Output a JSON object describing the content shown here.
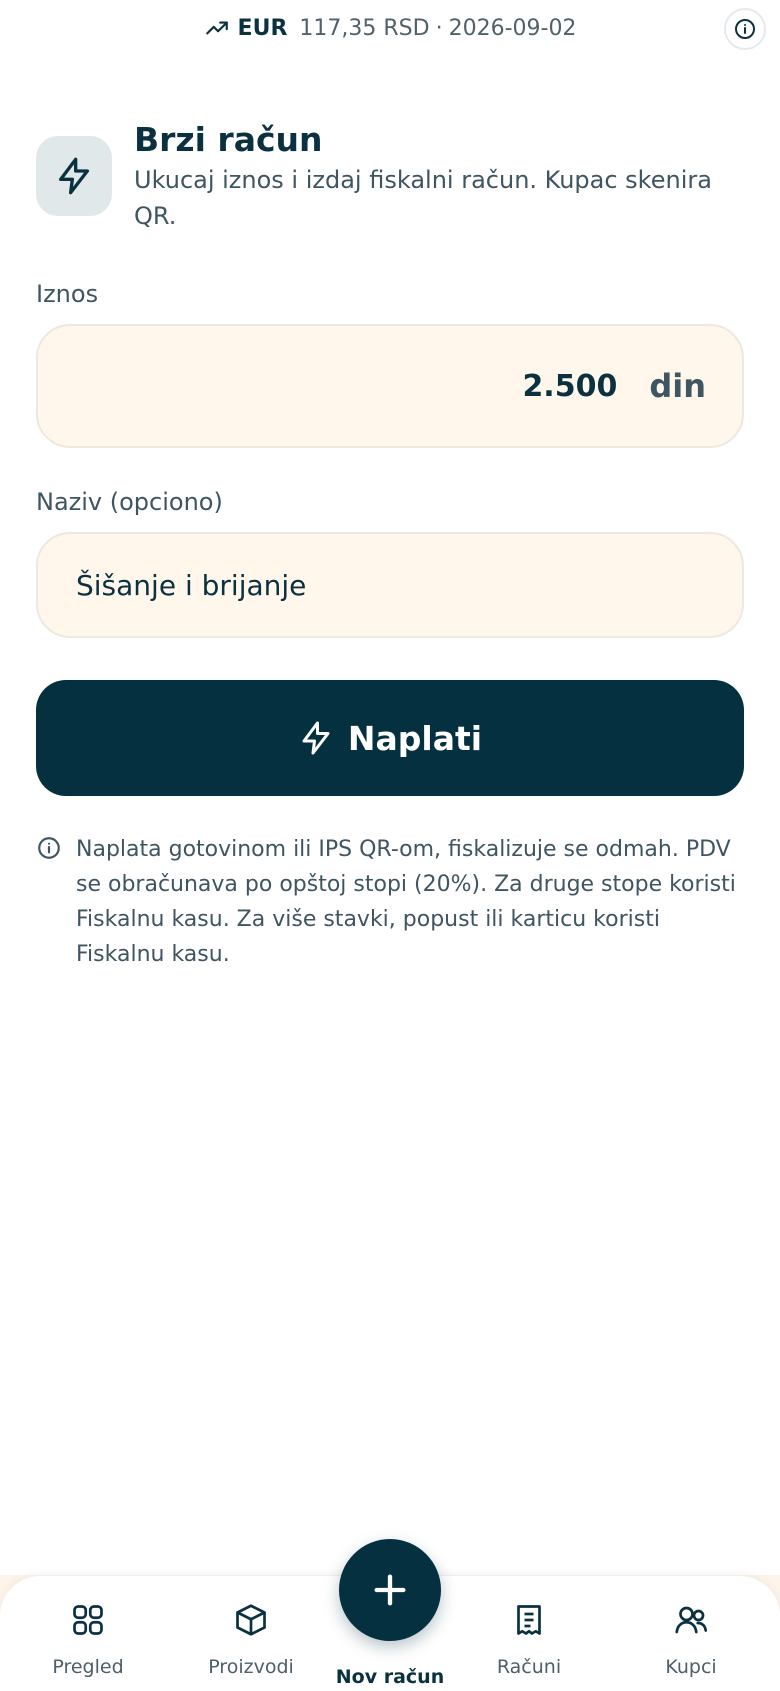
{
  "rate_bar": {
    "currency": "EUR",
    "rate": "117,35",
    "unit": "RSD",
    "separator": "·",
    "date": "2026-09-02"
  },
  "header": {
    "title": "Brzi račun",
    "subtitle": "Ukucaj iznos i izdaj fiskalni račun. Kupac skenira QR."
  },
  "form": {
    "amount_label": "Iznos",
    "amount_value": "2.500",
    "amount_unit": "din",
    "name_label": "Naziv (opciono)",
    "name_value": "Šišanje i brijanje"
  },
  "pay_button": {
    "label": "Naplati"
  },
  "note": {
    "text": "Naplata gotovinom ili IPS QR-om, fiskalizuje se odmah. PDV se obračunava po opštoj stopi (20%). Za druge stope koristi Fiskalnu kasu. Za više stavki, popust ili karticu koristi Fiskalnu kasu."
  },
  "nav": {
    "items": [
      {
        "label": "Pregled",
        "icon": "grid-icon"
      },
      {
        "label": "Proizvodi",
        "icon": "box-icon"
      },
      {
        "label": "Nov račun",
        "icon": "plus-icon"
      },
      {
        "label": "Računi",
        "icon": "receipt-icon"
      },
      {
        "label": "Kupci",
        "icon": "users-icon"
      }
    ]
  },
  "colors": {
    "primary": "#05303f",
    "input_bg": "#fff7ec",
    "text": "#0b3140",
    "muted": "#3f5562"
  }
}
